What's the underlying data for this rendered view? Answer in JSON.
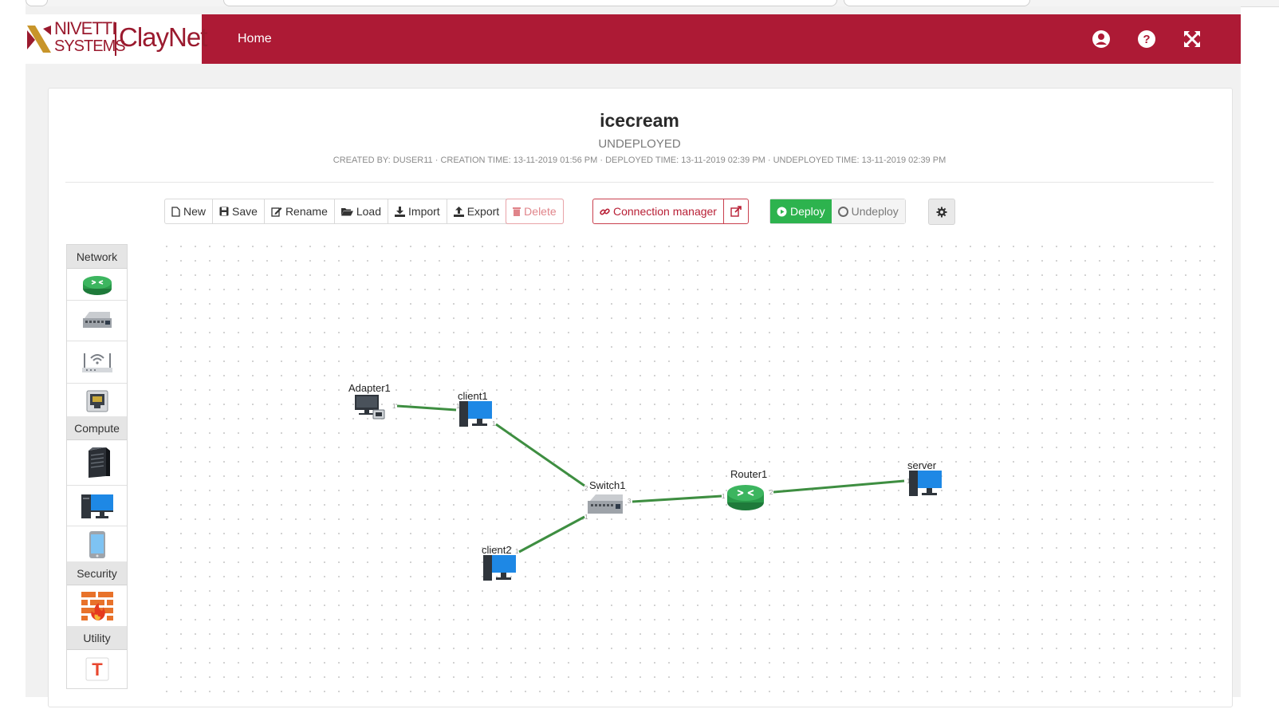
{
  "header": {
    "logo": {
      "line1": "NIVETTI",
      "line2": "SYSTEMS",
      "product": "ClayNet"
    },
    "nav_home": "Home",
    "icons": [
      "user-circle-icon",
      "help-circle-icon",
      "fullscreen-icon"
    ],
    "bar_color": "#ad1a35"
  },
  "project": {
    "name": "icecream",
    "status": "UNDEPLOYED",
    "meta": "CREATED BY: DUSER11 · CREATION TIME: 13-11-2019 01:56 PM · DEPLOYED TIME: 13-11-2019 02:39 PM · UNDEPLOYED TIME: 13-11-2019 02:39 PM"
  },
  "toolbar": {
    "new": "New",
    "save": "Save",
    "rename": "Rename",
    "load": "Load",
    "import": "Import",
    "export": "Export",
    "delete": "Delete",
    "connection_manager": "Connection manager",
    "deploy": "Deploy",
    "undeploy": "Undeploy"
  },
  "palette": {
    "sections": [
      {
        "title": "Network",
        "items": [
          "router-icon",
          "switch-icon",
          "wireless-ap-icon",
          "network-adapter-icon"
        ]
      },
      {
        "title": "Compute",
        "items": [
          "server-tower-icon",
          "desktop-computer-icon",
          "mobile-device-icon"
        ]
      },
      {
        "title": "Security",
        "items": [
          "firewall-icon"
        ]
      },
      {
        "title": "Utility",
        "items": [
          "text-tool-icon"
        ]
      }
    ]
  },
  "topology": {
    "link_color": "#3e8e41",
    "nodes": [
      {
        "id": "adapter1",
        "label": "Adapter1",
        "type": "adapter"
      },
      {
        "id": "client1",
        "label": "client1",
        "type": "desktop"
      },
      {
        "id": "switch1",
        "label": "Switch1",
        "type": "switch"
      },
      {
        "id": "client2",
        "label": "client2",
        "type": "desktop"
      },
      {
        "id": "router1",
        "label": "Router1",
        "type": "router"
      },
      {
        "id": "server",
        "label": "server",
        "type": "desktop"
      }
    ],
    "links": [
      {
        "from": "adapter1",
        "to": "client1",
        "from_port": "1",
        "to_port": "1"
      },
      {
        "from": "client1",
        "to": "switch1",
        "from_port": "1",
        "to_port": "2"
      },
      {
        "from": "client2",
        "to": "switch1",
        "from_port": "1",
        "to_port": "1"
      },
      {
        "from": "switch1",
        "to": "router1",
        "from_port": "3",
        "to_port": "1"
      },
      {
        "from": "router1",
        "to": "server",
        "from_port": "2",
        "to_port": "1"
      }
    ]
  }
}
